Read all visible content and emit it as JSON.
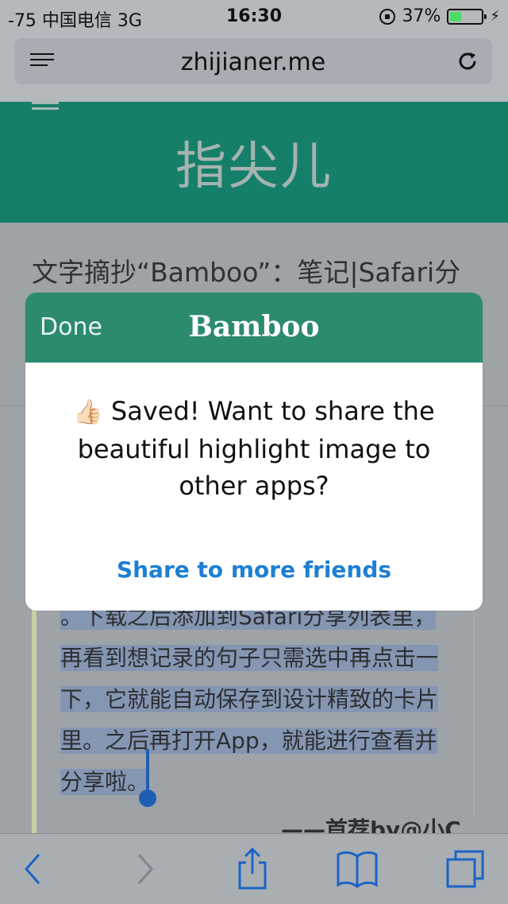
{
  "status_bar": {
    "carrier": "-75 中国电信   3G",
    "time": "16:30",
    "battery": "37%",
    "battery_level": 0.37
  },
  "address_bar": {
    "url": "zhijianer.me",
    "icons": [
      "menu-icon",
      "reload-icon"
    ]
  },
  "page": {
    "site_title": "指尖儿",
    "article_title": "文字摘抄“Bamboo”：笔记|Safari分",
    "quote_lines": [
      "。下载之后添加到Safari分享列表里，",
      "再看到想记录的句子只需选中再点击一",
      "下，它就能自动保存到设计精致的卡片",
      "里。之后再打开App，就能进行查看并",
      "分享啦。"
    ],
    "byline": "——首荐by@小C"
  },
  "modal": {
    "done_label": "Done",
    "title": "Bamboo",
    "message": "Saved! Want to share the beautiful highlight image to other apps?",
    "thumb_emoji": "👍🏻",
    "link_label": "Share to more friends"
  },
  "toolbar": {
    "icons": [
      "back-icon",
      "forward-icon",
      "share-icon",
      "bookmarks-icon",
      "tabs-icon"
    ]
  },
  "colors": {
    "header_green": "#167f69",
    "modal_header_green": "#2b8a70",
    "link_blue": "#1d7fd3",
    "toolbar_blue": "#1a63c6",
    "battery_green": "#4cd964"
  }
}
